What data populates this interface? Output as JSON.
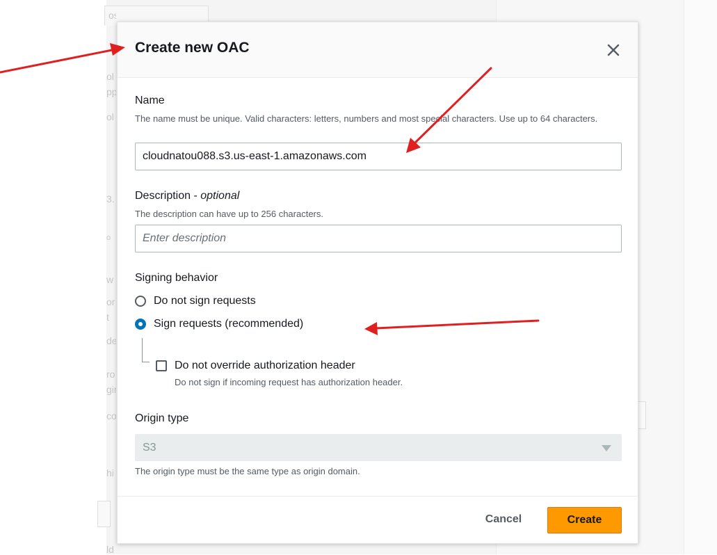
{
  "background": {
    "fragments": [
      "osite endpoint",
      "ol",
      "pp",
      "ol",
      "3.",
      "o",
      "w",
      "or",
      "t",
      "de",
      "ro",
      "gin",
      "co",
      "hi",
      "ld"
    ]
  },
  "modal": {
    "title": "Create new OAC",
    "close_icon": "close-icon",
    "name": {
      "label": "Name",
      "help": "The name must be unique. Valid characters: letters, numbers and most special characters. Use up to 64 characters.",
      "value": "cloudnatou088.s3.us-east-1.amazonaws.com"
    },
    "description": {
      "label": "Description - ",
      "label_optional": "optional",
      "help": "The description can have up to 256 characters.",
      "placeholder": "Enter description",
      "value": ""
    },
    "signing": {
      "label": "Signing behavior",
      "options": [
        {
          "label": "Do not sign requests",
          "checked": false
        },
        {
          "label": "Sign requests (recommended)",
          "checked": true
        }
      ],
      "override": {
        "label": "Do not override authorization header",
        "help": "Do not sign if incoming request has authorization header.",
        "checked": false
      }
    },
    "origin_type": {
      "label": "Origin type",
      "value": "S3",
      "help": "The origin type must be the same type as origin domain.",
      "disabled": true
    },
    "footer": {
      "cancel_label": "Cancel",
      "create_label": "Create"
    }
  },
  "colors": {
    "primary_button": "#ff9900",
    "radio_selected": "#0073bb",
    "annotation_arrow": "#e02020"
  }
}
